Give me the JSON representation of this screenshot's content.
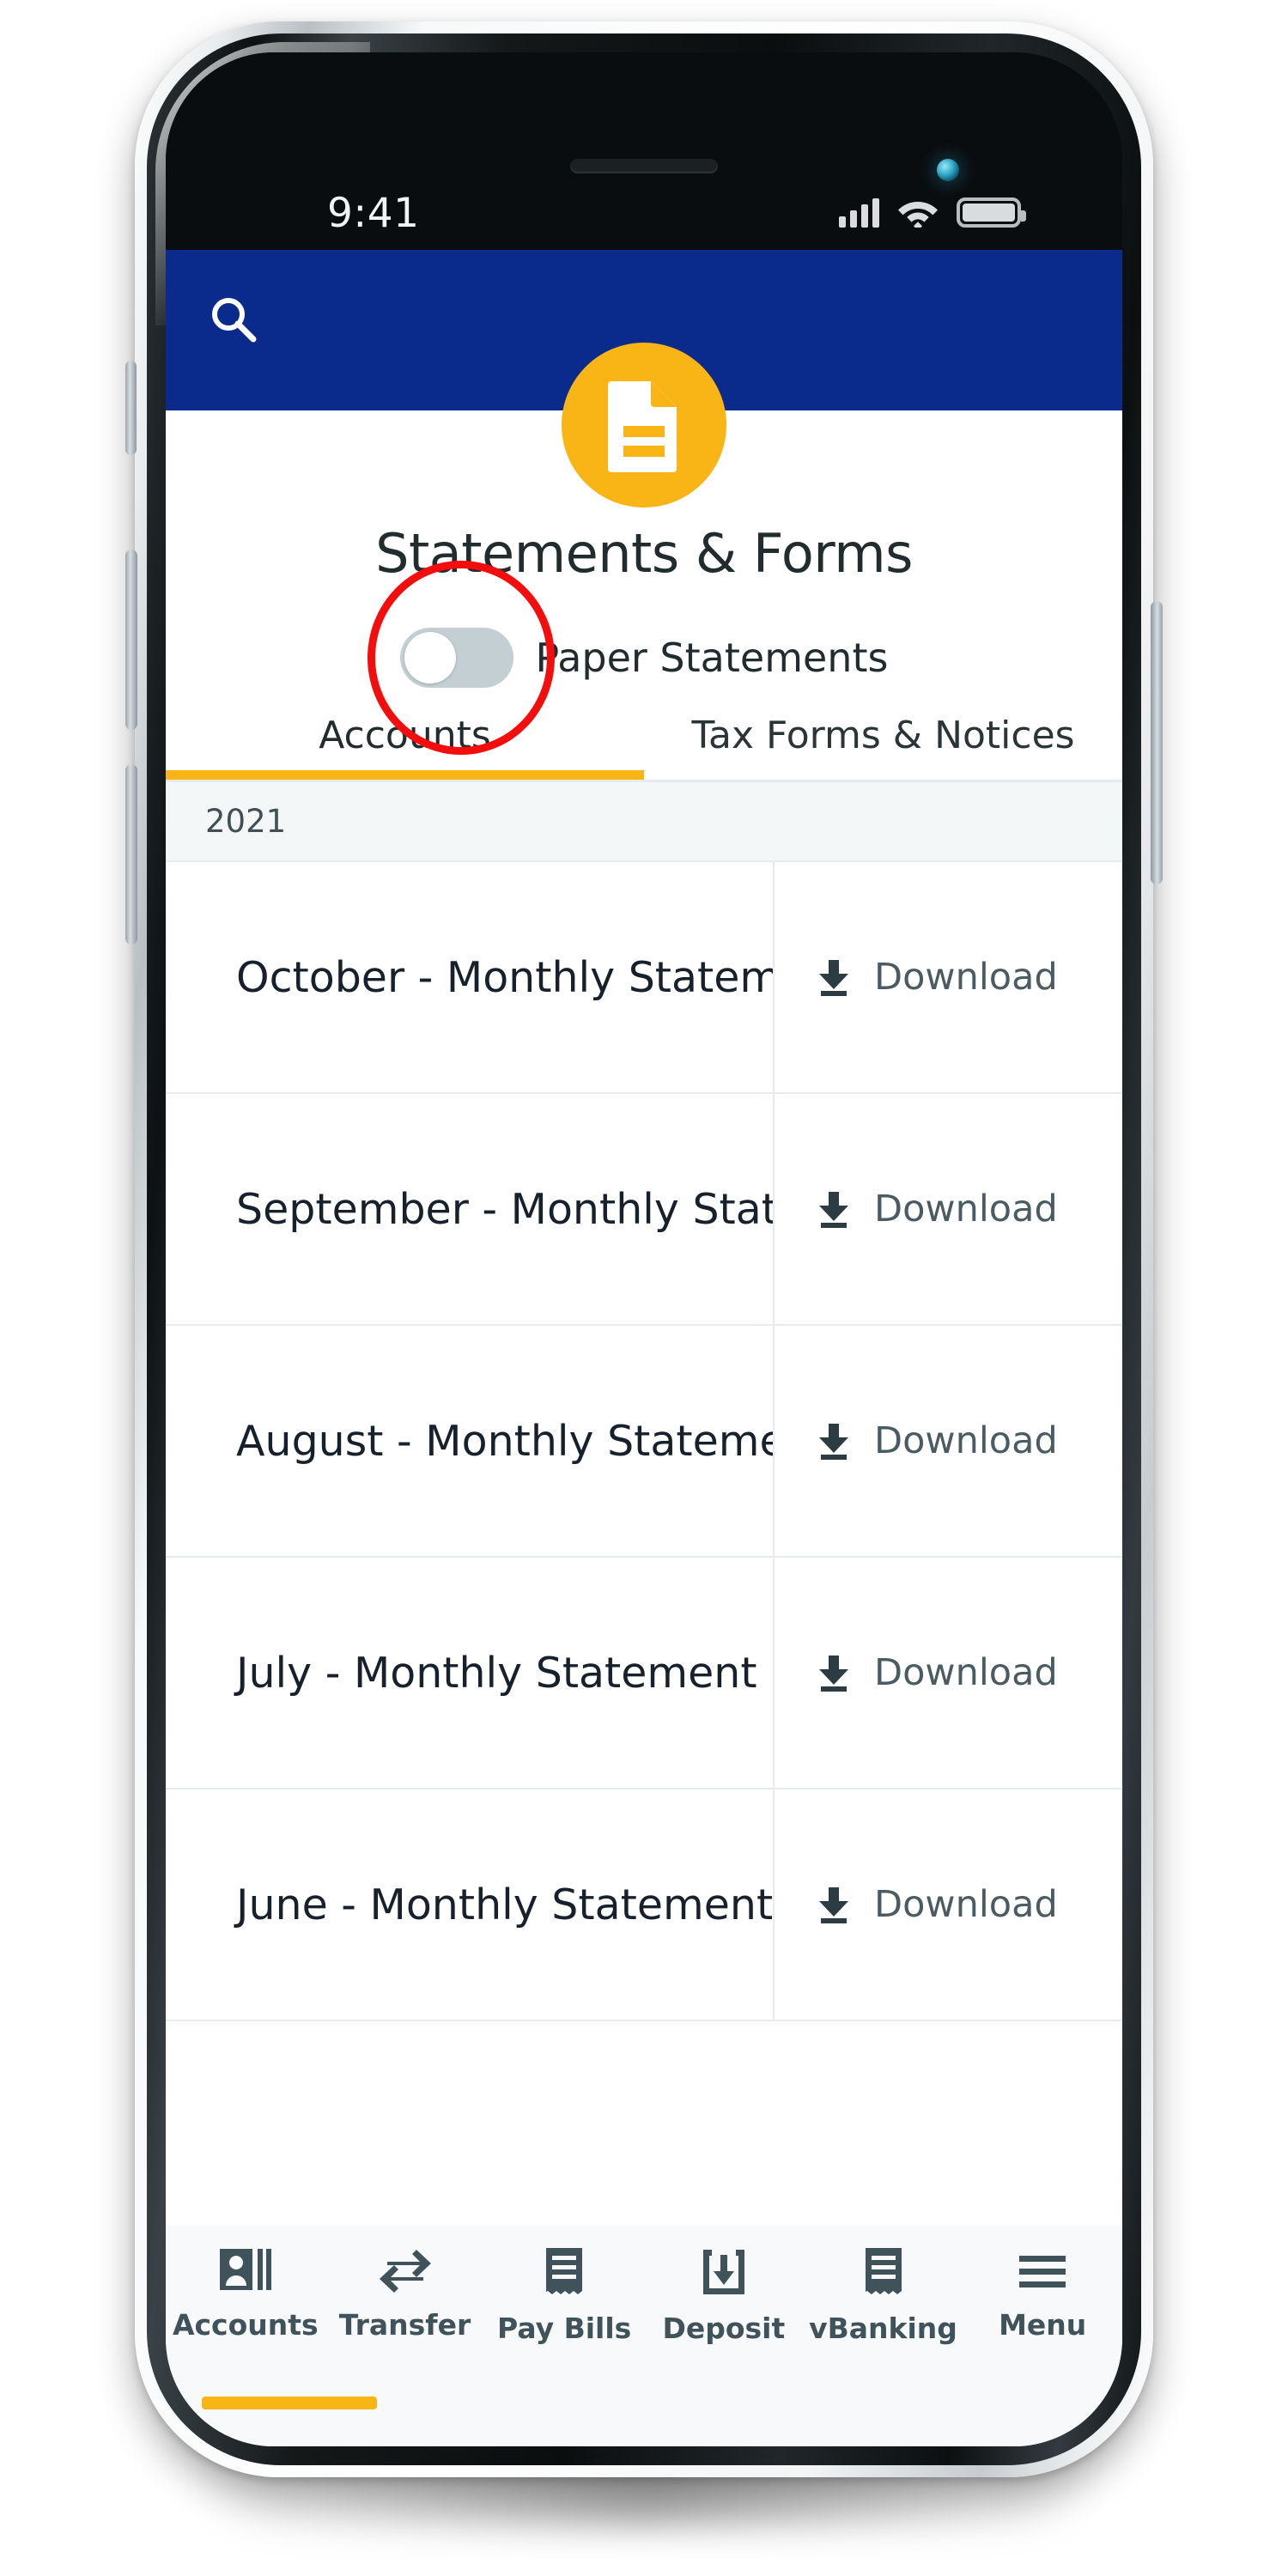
{
  "status_bar": {
    "time": "9:41",
    "signal_icon": "cellular-signal-icon",
    "wifi_icon": "wifi-icon",
    "battery_icon": "battery-icon"
  },
  "app_bar": {
    "search_icon": "search-icon",
    "brand_icon": "document-icon",
    "background_color": "#0a2b8c",
    "accent_color": "#f9b516"
  },
  "page_title": "Statements & Forms",
  "paper_statements": {
    "label": "Paper Statements",
    "state": "off",
    "annotation_color": "#f30d0d"
  },
  "tabs": [
    {
      "label": "Accounts",
      "active": true
    },
    {
      "label": "Tax Forms & Notices",
      "active": false
    }
  ],
  "list": {
    "year_header": "2021",
    "download_label": "Download",
    "download_icon": "download-icon",
    "rows": [
      {
        "title": "October - Monthly Statement"
      },
      {
        "title": "September - Monthly State..."
      },
      {
        "title": "August - Monthly Statement"
      },
      {
        "title": "July - Monthly Statement"
      },
      {
        "title": "June - Monthly Statement"
      }
    ]
  },
  "bottom_nav": [
    {
      "label": "Accounts",
      "icon": "id-card-icon",
      "active": true
    },
    {
      "label": "Transfer",
      "icon": "transfer-arrows-icon",
      "active": false
    },
    {
      "label": "Pay Bills",
      "icon": "receipt-icon",
      "active": false
    },
    {
      "label": "Deposit",
      "icon": "deposit-box-icon",
      "active": false
    },
    {
      "label": "vBanking",
      "icon": "receipt-icon",
      "active": false
    },
    {
      "label": "Menu",
      "icon": "hamburger-icon",
      "active": false
    }
  ]
}
